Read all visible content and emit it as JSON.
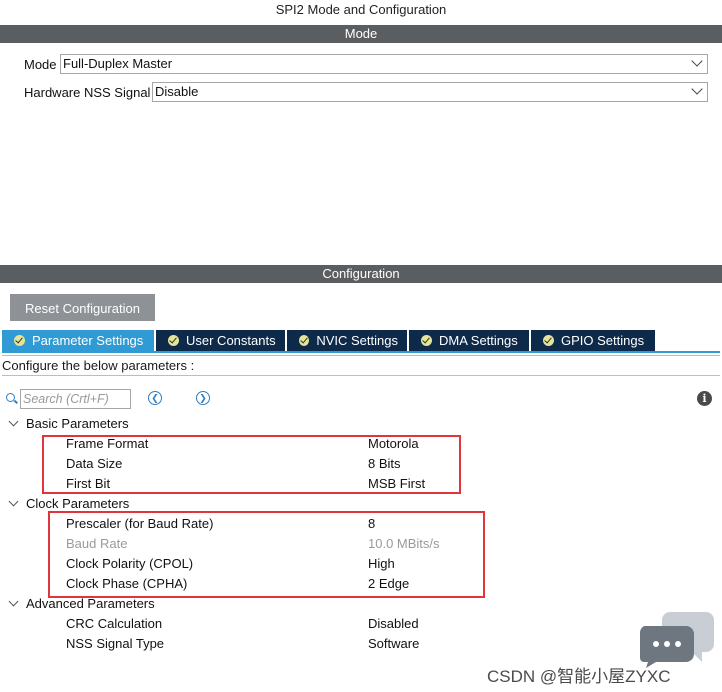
{
  "window": {
    "title": "SPI2 Mode and Configuration"
  },
  "mode_section": {
    "header": "Mode",
    "mode_label": "Mode",
    "mode_value": "Full-Duplex Master",
    "nss_label": "Hardware NSS Signal",
    "nss_value": "Disable"
  },
  "config_section": {
    "header": "Configuration",
    "reset_button": "Reset Configuration",
    "tabs": [
      {
        "label": "Parameter Settings",
        "active": true
      },
      {
        "label": "User Constants",
        "active": false
      },
      {
        "label": "NVIC Settings",
        "active": false
      },
      {
        "label": "DMA Settings",
        "active": false
      },
      {
        "label": "GPIO Settings",
        "active": false
      }
    ],
    "description": "Configure the below parameters :",
    "search_placeholder": "Search (Crtl+F)",
    "prev_icon": "chevron-left-circle-icon",
    "next_icon": "chevron-right-circle-icon",
    "info_icon": "info-icon",
    "info_glyph": "i"
  },
  "parameters": {
    "basic": {
      "title": "Basic Parameters",
      "items": [
        {
          "name": "Frame Format",
          "value": "Motorola"
        },
        {
          "name": "Data Size",
          "value": "8 Bits"
        },
        {
          "name": "First Bit",
          "value": "MSB First"
        }
      ]
    },
    "clock": {
      "title": "Clock Parameters",
      "items": [
        {
          "name": "Prescaler (for Baud Rate)",
          "value": "8"
        },
        {
          "name": "Baud Rate",
          "value": "10.0 MBits/s"
        },
        {
          "name": "Clock Polarity (CPOL)",
          "value": "High"
        },
        {
          "name": "Clock Phase (CPHA)",
          "value": "2 Edge"
        }
      ]
    },
    "advanced": {
      "title": "Advanced Parameters",
      "items": [
        {
          "name": "CRC Calculation",
          "value": "Disabled"
        },
        {
          "name": "NSS Signal Type",
          "value": "Software"
        }
      ]
    }
  },
  "annotations": {
    "highlight_color": "#e0353a"
  },
  "watermark": {
    "text": "CSDN @智能小屋ZYXC"
  }
}
